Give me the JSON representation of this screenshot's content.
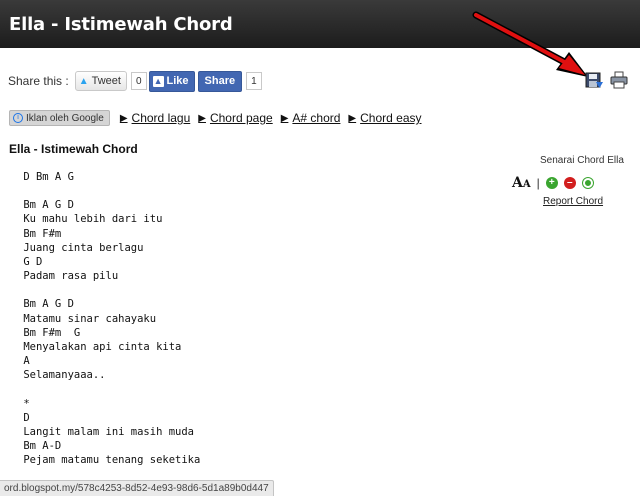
{
  "page": {
    "title": "Ella - Istimewah Chord"
  },
  "share": {
    "label": "Share this :",
    "tweet_label": "Tweet",
    "tweet_count": "0",
    "like_label": "Like",
    "share_label": "Share",
    "share_count": "1"
  },
  "links": {
    "ads_label": "Iklan oleh Google",
    "items": [
      "Chord lagu",
      "Chord page",
      "A# chord",
      "Chord easy"
    ]
  },
  "song": {
    "title": "Ella - Istimewah Chord"
  },
  "sidebar": {
    "list_label": "Senarai Chord Ella",
    "font_glyph": "A",
    "report_label": "Report Chord"
  },
  "lyrics": " D Bm A G\n\n Bm A G D\n Ku mahu lebih dari itu\n Bm F#m\n Juang cinta berlagu\n G D\n Padam rasa pilu\n\n Bm A G D\n Matamu sinar cahayaku\n Bm F#m  G\n Menyalakan api cinta kita\n A\n Selamanyaaa..\n\n *\n D\n Langit malam ini masih muda\n Bm A-D\n Pejam matamu tenang seketika",
  "statusbar": {
    "url": "ord.blogspot.my/578c4253-8d52-4e93-98d6-5d1a89b0d447"
  },
  "colors": {
    "annotation_arrow": "#e01010",
    "facebook": "#4267b2"
  }
}
